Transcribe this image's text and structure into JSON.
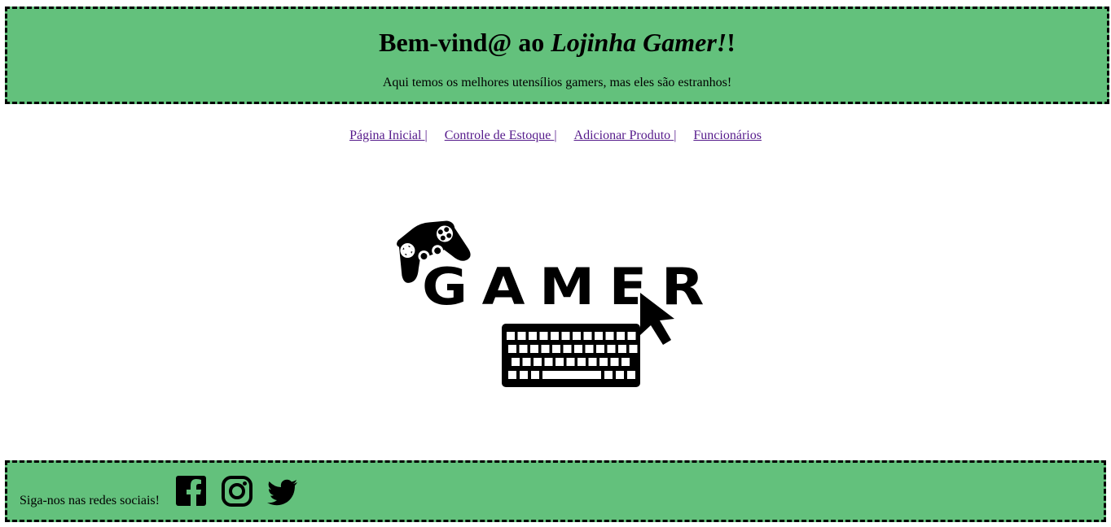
{
  "header": {
    "title_prefix": "Bem-vind@ ao ",
    "title_store": "Lojinha Gamer!",
    "title_suffix": "!",
    "subtitle": "Aqui temos os melhores utensílios gamers, mas eles são estranhos!"
  },
  "nav": {
    "items": [
      {
        "label": "Página Inicial ",
        "separator": "|"
      },
      {
        "label": "Controle de Estoque ",
        "separator": "|"
      },
      {
        "label": "Adicionar Produto ",
        "separator": "|"
      },
      {
        "label": "Funcionários",
        "separator": ""
      }
    ]
  },
  "logo": {
    "text": "GAMER",
    "icons": [
      "gamepad-icon",
      "keyboard-icon",
      "cursor-icon"
    ]
  },
  "footer": {
    "follow_text": "Siga-nos nas redes sociais!",
    "social": [
      "facebook-icon",
      "instagram-icon",
      "twitter-icon"
    ]
  },
  "colors": {
    "header_bg": "#63c17c",
    "footer_bg": "#63c17c",
    "link": "#551a8b"
  }
}
